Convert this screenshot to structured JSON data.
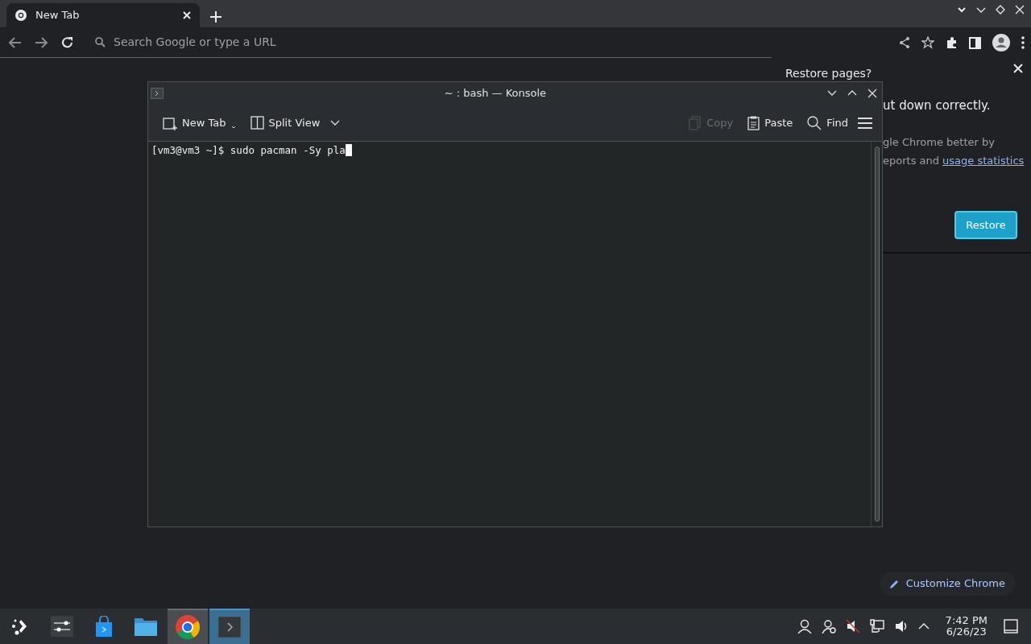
{
  "browser": {
    "tabs": [
      {
        "title": "New Tab",
        "selected": true
      }
    ],
    "address_bar": {
      "placeholder": "Search Google or type a URL"
    }
  },
  "restore_bubble": {
    "title": "Restore pages?",
    "message": "ut down correctly.",
    "detail_line_1": "gle Chrome better by",
    "detail_line_2": "eports and",
    "link": "usage statistics",
    "button": "Restore"
  },
  "customize_button": "Customize Chrome",
  "konsole": {
    "title": "~ : bash — Konsole",
    "toolbar": [
      {
        "label": "New Tab",
        "kind": "newtab",
        "disabled": false
      },
      {
        "label": "Split View",
        "kind": "split",
        "disabled": false
      },
      {
        "label": "Copy",
        "kind": "copy",
        "disabled": true
      },
      {
        "label": "Paste",
        "kind": "paste",
        "disabled": false
      },
      {
        "label": "Find",
        "kind": "find",
        "disabled": false
      }
    ],
    "prompt": "[vm3@vm3 ~]$ sudo pacman -Sy pla"
  },
  "taskbar": {
    "apps": [
      {
        "kind": "launcher",
        "running": false,
        "selected": false
      },
      {
        "kind": "settings",
        "running": false,
        "selected": false
      },
      {
        "kind": "store",
        "running": false,
        "selected": false
      },
      {
        "kind": "files",
        "running": false,
        "selected": false
      },
      {
        "kind": "chrome",
        "running": true,
        "selected": false
      },
      {
        "kind": "konsole",
        "running": true,
        "selected": true
      }
    ],
    "time": "7:42 PM",
    "date": "6/26/23"
  }
}
